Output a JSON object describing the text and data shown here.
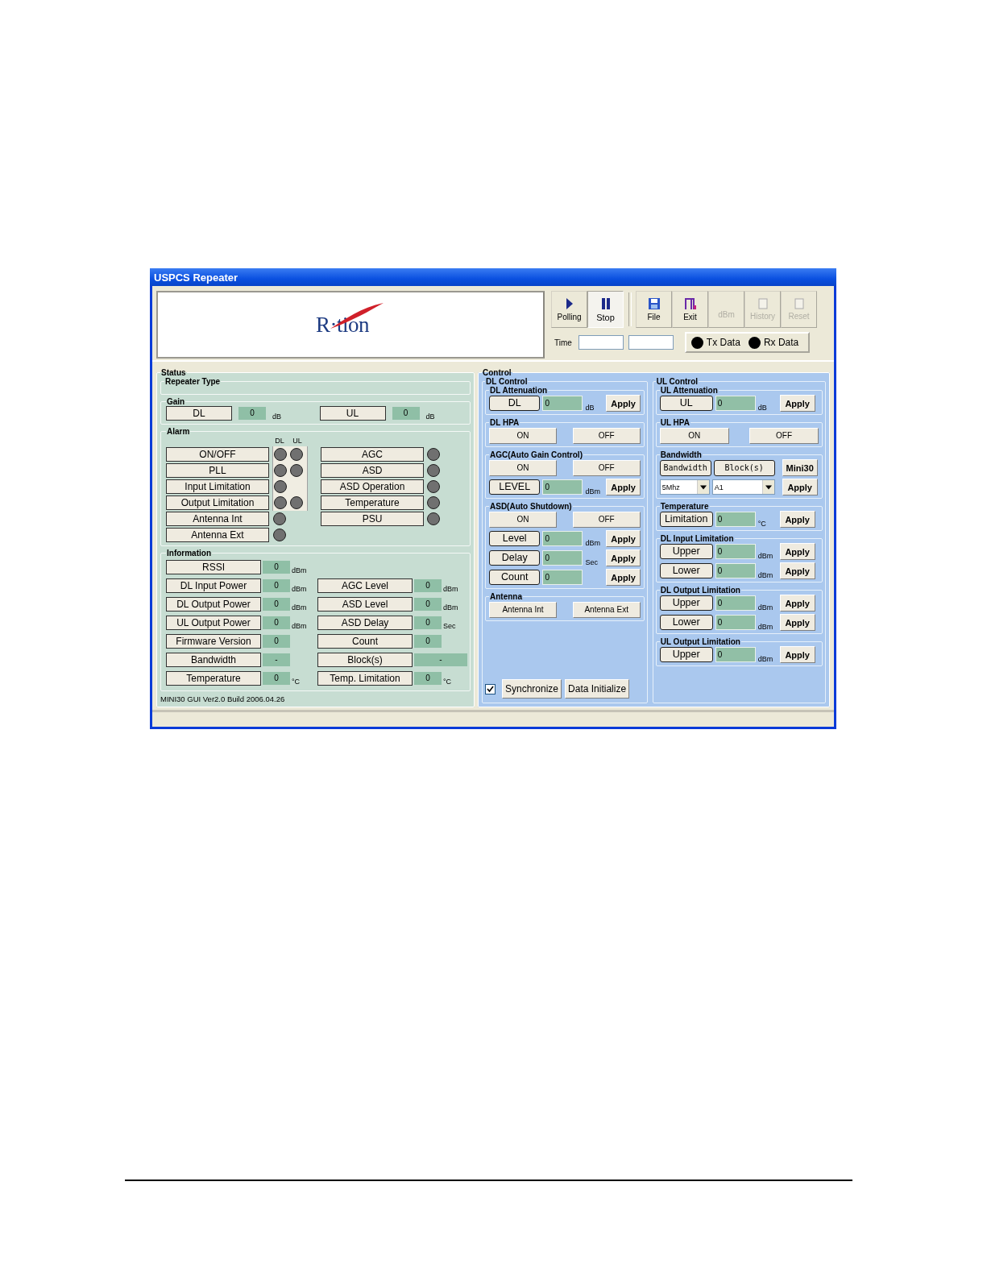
{
  "window": {
    "title": "USPCS Repeater"
  },
  "logo": {
    "text": "R·tion"
  },
  "toolbar": [
    {
      "label": "Polling",
      "kind": "play",
      "pressed": false,
      "disabled": false,
      "separator_before": false
    },
    {
      "label": "Stop",
      "kind": "pause",
      "pressed": true,
      "disabled": false,
      "separator_before": false
    },
    {
      "label": "File",
      "kind": "disk",
      "pressed": false,
      "disabled": false,
      "separator_before": true
    },
    {
      "label": "Exit",
      "kind": "door",
      "pressed": false,
      "disabled": false,
      "separator_before": false
    },
    {
      "label": "dBm",
      "kind": "plain",
      "pressed": false,
      "disabled": true,
      "separator_before": false
    },
    {
      "label": "History",
      "kind": "page",
      "pressed": false,
      "disabled": true,
      "separator_before": false
    },
    {
      "label": "Reset",
      "kind": "page",
      "pressed": false,
      "disabled": true,
      "separator_before": false
    }
  ],
  "time": {
    "label": "Time"
  },
  "indicators": [
    {
      "label": "Tx Data"
    },
    {
      "label": "Rx Data"
    }
  ],
  "status": {
    "title": "Status",
    "repeater_type": {
      "title": "Repeater Type"
    },
    "gain": {
      "title": "Gain",
      "items": [
        {
          "label": "DL",
          "value": "0",
          "unit": "dB"
        },
        {
          "label": "UL",
          "value": "0",
          "unit": "dB"
        }
      ]
    },
    "alarm": {
      "title": "Alarm",
      "columns": [
        "DL",
        "UL"
      ],
      "left": [
        {
          "label": "ON/OFF",
          "leds": [
            {
              "lit": false
            },
            {
              "lit": false
            }
          ]
        },
        {
          "label": "PLL",
          "leds": [
            {
              "lit": false
            },
            {
              "lit": false
            }
          ]
        },
        {
          "label": "Input Limitation",
          "leds": [
            {
              "lit": false
            }
          ]
        },
        {
          "label": "Output Limitation",
          "leds": [
            {
              "lit": false
            },
            {
              "lit": false
            }
          ]
        }
      ],
      "left_extra": [
        {
          "label": "Antenna Int",
          "leds": [
            {
              "lit": false
            }
          ]
        },
        {
          "label": "Antenna Ext",
          "leds": [
            {
              "lit": false
            }
          ]
        }
      ],
      "right": [
        {
          "label": "AGC",
          "leds": [
            {
              "lit": false
            }
          ]
        },
        {
          "label": "ASD",
          "leds": [
            {
              "lit": false
            }
          ]
        },
        {
          "label": "ASD Operation",
          "leds": [
            {
              "lit": false
            }
          ]
        },
        {
          "label": "Temperature",
          "leds": [
            {
              "lit": false
            }
          ]
        },
        {
          "label": "PSU",
          "leds": [
            {
              "lit": false
            }
          ]
        }
      ]
    },
    "information": {
      "title": "Information",
      "rows": [
        {
          "cells": [
            {
              "label": "RSSI",
              "value": "0",
              "unit": "dBm"
            }
          ]
        },
        {
          "cells": [
            {
              "label": "DL Input Power",
              "value": "0",
              "unit": "dBm"
            },
            {
              "label": "AGC Level",
              "value": "0",
              "unit": "dBm"
            }
          ]
        },
        {
          "cells": [
            {
              "label": "DL Output Power",
              "value": "0",
              "unit": "dBm"
            },
            {
              "label": "ASD Level",
              "value": "0",
              "unit": "dBm"
            }
          ]
        },
        {
          "cells": [
            {
              "label": "UL Output Power",
              "value": "0",
              "unit": "dBm"
            },
            {
              "label": "ASD Delay",
              "value": "0",
              "unit": "Sec"
            }
          ]
        },
        {
          "cells": [
            {
              "label": "Firmware Version",
              "value": "0"
            },
            {
              "label": "Count",
              "value": "0"
            }
          ]
        },
        {
          "cells": [
            {
              "label": "Bandwidth",
              "value": "-"
            },
            {
              "label": "Block(s)",
              "value": "-",
              "wide": true
            }
          ]
        },
        {
          "cells": [
            {
              "label": "Temperature",
              "value": "0",
              "unit": "°C"
            },
            {
              "label": "Temp. Limitation",
              "value": "0",
              "unit": "°C"
            }
          ]
        }
      ]
    },
    "version": "MINI30 GUI Ver2.0  Build 2006.04.26"
  },
  "control": {
    "title": "Control",
    "dl": {
      "title": "DL Control",
      "groups": [
        {
          "title": "DL Attenuation",
          "rows": [
            {
              "kind": "field",
              "label": "DL",
              "value": "0",
              "unit": "dB",
              "action": "Apply"
            }
          ]
        },
        {
          "title": "DL HPA",
          "rows": [
            {
              "kind": "buttons",
              "buttons": [
                "ON",
                "OFF"
              ]
            }
          ]
        },
        {
          "title": "AGC(Auto Gain Control)",
          "rows": [
            {
              "kind": "buttons",
              "buttons": [
                "ON",
                "OFF"
              ]
            },
            {
              "kind": "field",
              "label": "LEVEL",
              "value": "0",
              "unit": "dBm",
              "action": "Apply"
            }
          ]
        },
        {
          "title": "ASD(Auto Shutdown)",
          "rows": [
            {
              "kind": "buttons",
              "buttons": [
                "ON",
                "OFF"
              ]
            },
            {
              "kind": "field",
              "label": "Level",
              "value": "0",
              "unit": "dBm",
              "action": "Apply"
            },
            {
              "kind": "field",
              "label": "Delay",
              "value": "0",
              "unit": "Sec",
              "action": "Apply"
            },
            {
              "kind": "field",
              "label": "Count",
              "value": "0",
              "action": "Apply"
            }
          ]
        },
        {
          "title": "Antenna",
          "rows": [
            {
              "kind": "buttons",
              "buttons": [
                "Antenna Int",
                "Antenna Ext"
              ]
            }
          ]
        }
      ],
      "sync": {
        "checked": true,
        "label": "Synchronize"
      },
      "init": {
        "label": "Data Initialize"
      }
    },
    "ul": {
      "title": "UL Control",
      "groups": [
        {
          "title": "UL Attenuation",
          "rows": [
            {
              "kind": "field",
              "label": "UL",
              "value": "0",
              "unit": "dB",
              "action": "Apply"
            }
          ]
        },
        {
          "title": "UL HPA",
          "rows": [
            {
              "kind": "buttons",
              "buttons": [
                "ON",
                "OFF"
              ]
            }
          ]
        },
        {
          "title": "Bandwidth",
          "rows": [
            {
              "kind": "tabs",
              "buttons": [
                "Bandwidth",
                "Block(s)"
              ],
              "action": "Mini30"
            },
            {
              "kind": "selects",
              "selects": [
                "5Mhz",
                "A1"
              ],
              "action": "Apply"
            }
          ]
        },
        {
          "title": "Temperature",
          "rows": [
            {
              "kind": "field",
              "label": "Limitation",
              "value": "0",
              "unit": "°C",
              "action": "Apply"
            }
          ]
        },
        {
          "title": "DL Input Limitation",
          "rows": [
            {
              "kind": "field",
              "label": "Upper",
              "value": "0",
              "unit": "dBm",
              "action": "Apply"
            },
            {
              "kind": "field",
              "label": "Lower",
              "value": "0",
              "unit": "dBm",
              "action": "Apply"
            }
          ]
        },
        {
          "title": "DL Output Limitation",
          "rows": [
            {
              "kind": "field",
              "label": "Upper",
              "value": "0",
              "unit": "dBm",
              "action": "Apply"
            },
            {
              "kind": "field",
              "label": "Lower",
              "value": "0",
              "unit": "dBm",
              "action": "Apply"
            }
          ]
        },
        {
          "title": "UL Output Limitation",
          "rows": [
            {
              "kind": "field",
              "label": "Upper",
              "value": "0",
              "unit": "dBm",
              "action": "Apply"
            }
          ]
        }
      ]
    }
  }
}
